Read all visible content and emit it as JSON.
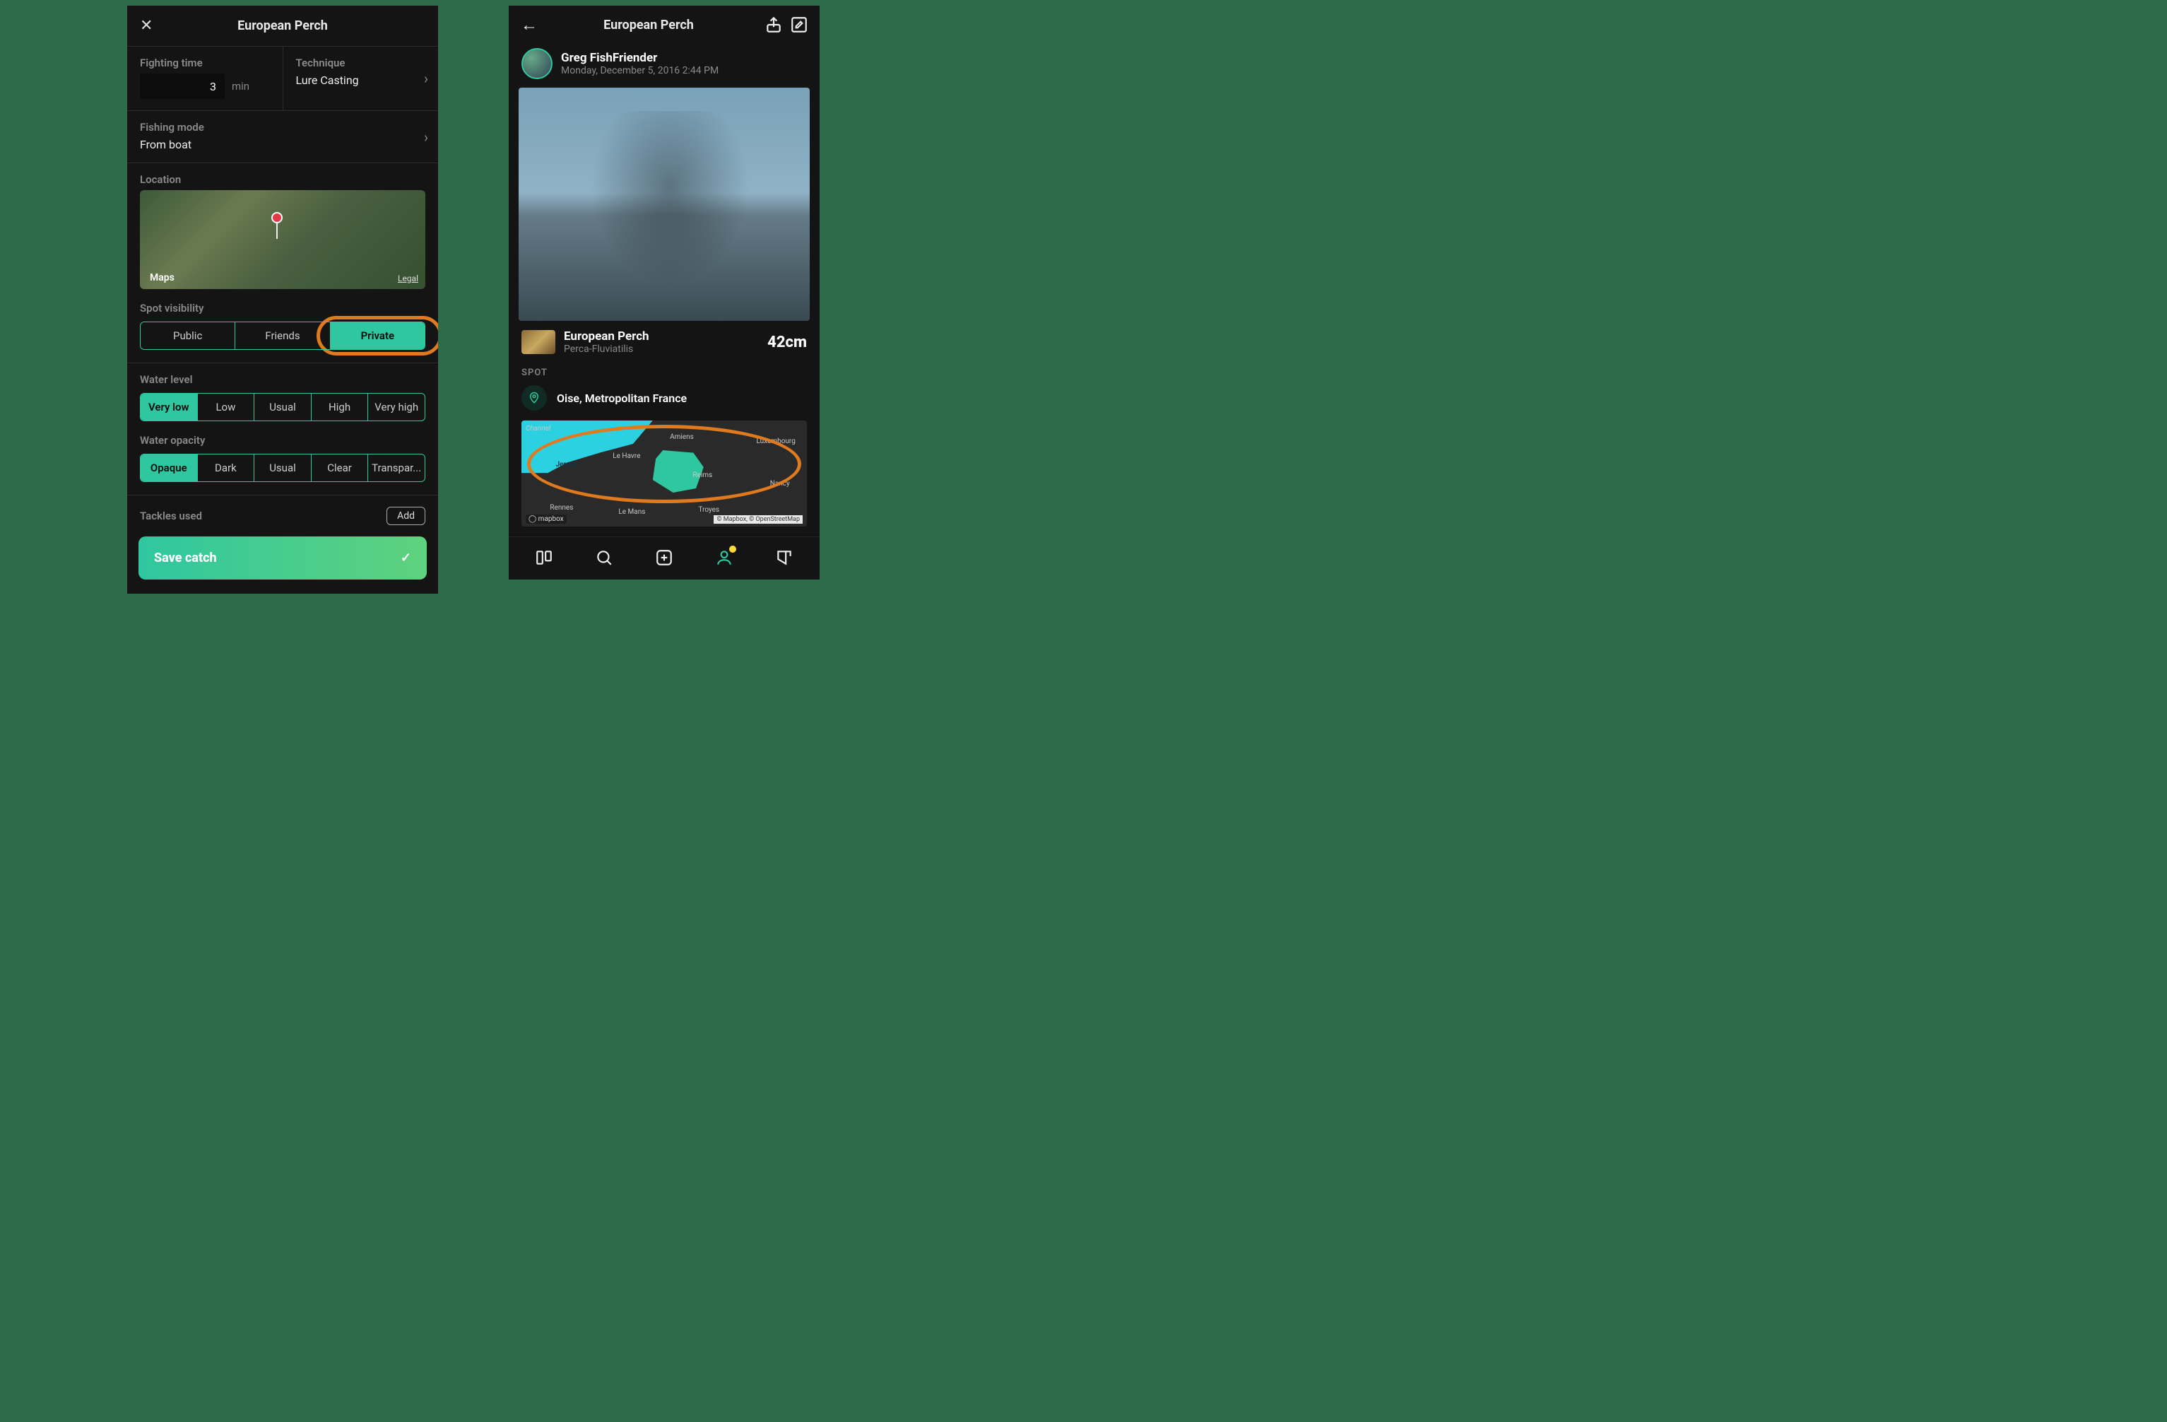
{
  "left": {
    "title": "European Perch",
    "fighting_time_label": "Fighting time",
    "fighting_time_value": "3",
    "fighting_time_unit": "min",
    "technique_label": "Technique",
    "technique_value": "Lure Casting",
    "fishing_mode_label": "Fishing mode",
    "fishing_mode_value": "From boat",
    "location_label": "Location",
    "map_brand": "Maps",
    "map_legal": "Legal",
    "spot_visibility_label": "Spot visibility",
    "visibility_options": {
      "o0": "Public",
      "o1": "Friends",
      "o2": "Private"
    },
    "water_level_label": "Water level",
    "water_level_options": {
      "o0": "Very low",
      "o1": "Low",
      "o2": "Usual",
      "o3": "High",
      "o4": "Very high"
    },
    "water_opacity_label": "Water opacity",
    "water_opacity_options": {
      "o0": "Opaque",
      "o1": "Dark",
      "o2": "Usual",
      "o3": "Clear",
      "o4": "Transpar..."
    },
    "tackles_label": "Tackles used",
    "add_label": "Add",
    "save_label": "Save catch"
  },
  "right": {
    "title": "European Perch",
    "user_name": "Greg FishFriender",
    "post_date": "Monday, December 5, 2016 2:44 PM",
    "species_name": "European Perch",
    "species_latin": "Perca-Fluviatilis",
    "size": "42cm",
    "spot_heading": "SPOT",
    "spot_name": "Oise, Metropolitan France",
    "mapbox": "mapbox",
    "map_credit": "© Mapbox, © OpenStreetMap",
    "cities": {
      "jersey": "Jersey",
      "lehavre": "Le Havre",
      "amiens": "Amiens",
      "reims": "Reims",
      "luxembourg": "Luxembourg",
      "nancy": "Nancy",
      "rennes": "Rennes",
      "lemans": "Le Mans",
      "troyes": "Troyes",
      "channel": "Channel"
    }
  }
}
